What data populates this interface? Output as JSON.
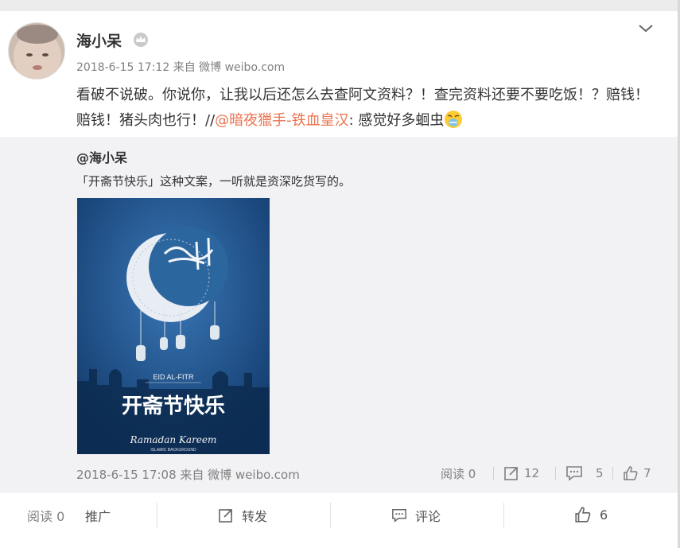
{
  "post": {
    "author": "海小呆",
    "meta": "2018-6-15 17:12 来自 微博 weibo.com",
    "text_part1": "看破不说破。你说你，让我以后还怎么去查阿文资料？！查完资料还要不要吃饭！？赔钱！赔钱！猪头肉也行！//",
    "mention": "@暗夜獵手-铁血皇汉",
    "text_part2": ": 感觉好多蛔虫",
    "emoji": "vomit-face-emoji"
  },
  "repost": {
    "user": "@海小呆",
    "text": "「开斋节快乐」这种文案，一听就是资深吃货写的。",
    "poster": {
      "eid_label": "EID AL-FITR",
      "title_cn": "开斋节快乐",
      "greeting": "Ramadan Kareem",
      "sub": "ISLAMIC BACKGROUND"
    },
    "meta": "2018-6-15 17:08 来自 微博 weibo.com",
    "read": "阅读 0",
    "forward_count": "12",
    "comment_count": "5",
    "like_count": "7"
  },
  "actions": {
    "read": "阅读 0",
    "promote": "推广",
    "forward": "转发",
    "comment": "评论",
    "like": "6"
  },
  "colors": {
    "mention": "#eb7350",
    "repost_bg": "#f2f2f5",
    "poster_bg": "#1f4f8a"
  }
}
